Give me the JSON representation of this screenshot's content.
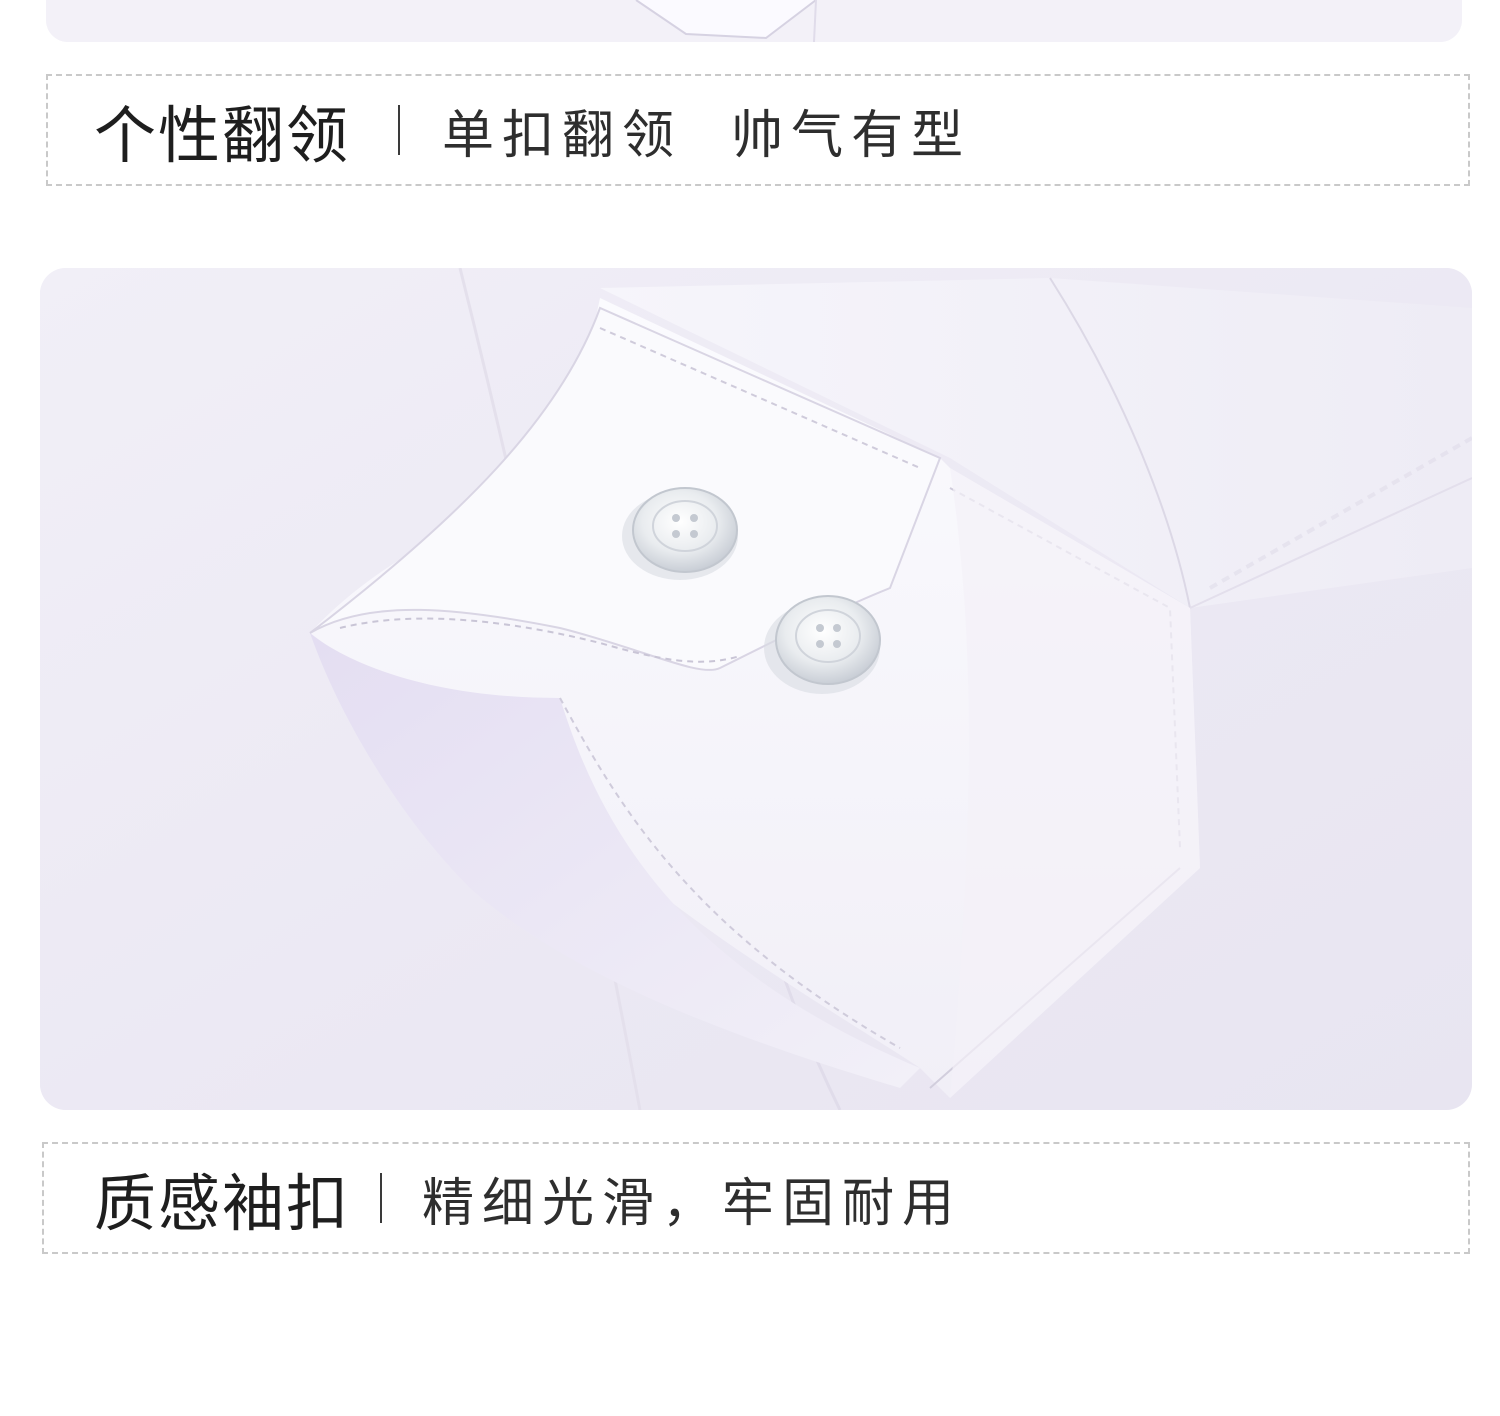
{
  "features": [
    {
      "title": "个性翻领",
      "subtitle": "单扣翻领  帅气有型"
    },
    {
      "title": "质感袖扣",
      "subtitle": "精细光滑，牢固耐用"
    }
  ],
  "colors": {
    "text_title": "#1e1e1e",
    "text_sub": "#2e2e2e",
    "dashed_border": "#c9c9c9",
    "fabric": "#f4f2f9",
    "fabric_shadow": "#e2deee"
  }
}
